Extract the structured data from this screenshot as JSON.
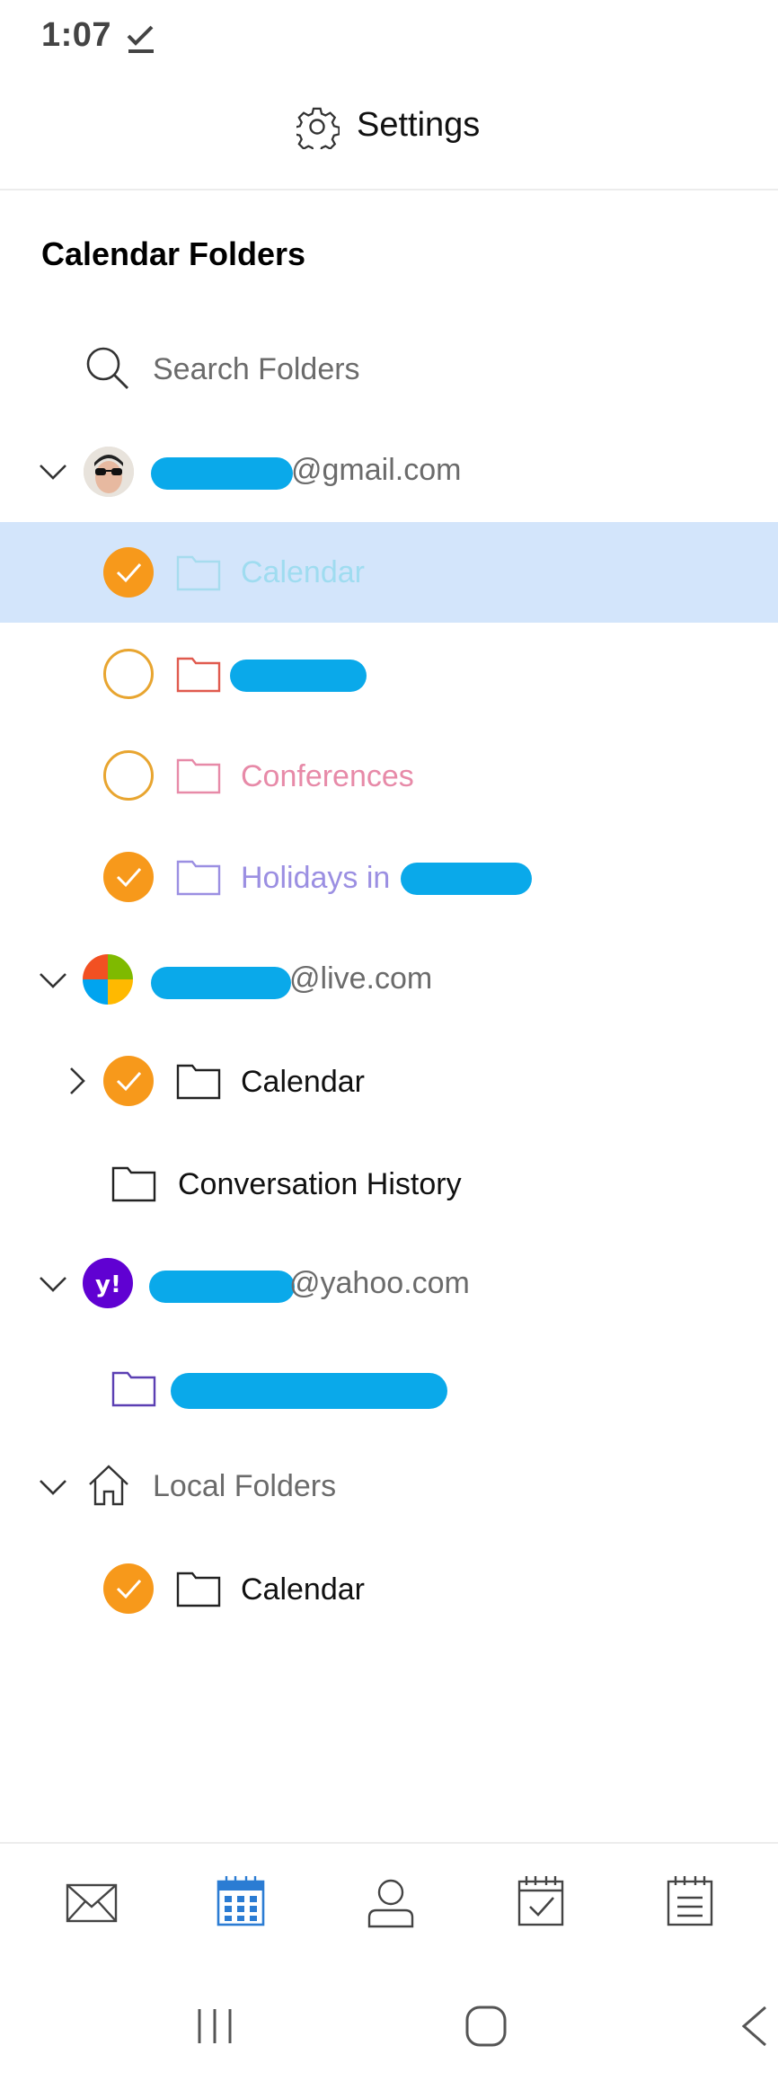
{
  "status": {
    "time": "1:07"
  },
  "header": {
    "title": "Settings"
  },
  "section_title": "Calendar Folders",
  "search": {
    "placeholder": "Search Folders"
  },
  "accounts": [
    {
      "suffix": "@gmail.com",
      "folders": [
        {
          "label": "Calendar",
          "checked": true,
          "color": "#9fdcf0",
          "selected": true
        },
        {
          "label": "",
          "checked": false,
          "color": "#e05a4e",
          "redacted": true
        },
        {
          "label": "Conferences",
          "checked": false,
          "color": "#e78aa8"
        },
        {
          "label": "Holidays in",
          "checked": true,
          "color": "#9b8fe2",
          "redacted_tail": true
        }
      ]
    },
    {
      "suffix": "@live.com",
      "folders": [
        {
          "label": "Calendar",
          "checked": true,
          "color": "#111111",
          "expandable": true
        },
        {
          "label": "Conversation History",
          "color": "#111111"
        }
      ]
    },
    {
      "suffix": "@yahoo.com",
      "folders": [
        {
          "label": "",
          "color": "#5b3fb3",
          "redacted": true
        }
      ]
    }
  ],
  "local": {
    "label": "Local Folders",
    "folders": [
      {
        "label": "Calendar",
        "checked": true,
        "color": "#111111"
      }
    ]
  },
  "bottom_nav": [
    "mail-icon",
    "calendar-icon",
    "person-icon",
    "tasks-icon",
    "notes-icon"
  ],
  "colors": {
    "accent": "#2b7cd3",
    "check": "#f7991b",
    "selected_row": "#d3e5fb",
    "redaction": "#0aa9ea"
  }
}
